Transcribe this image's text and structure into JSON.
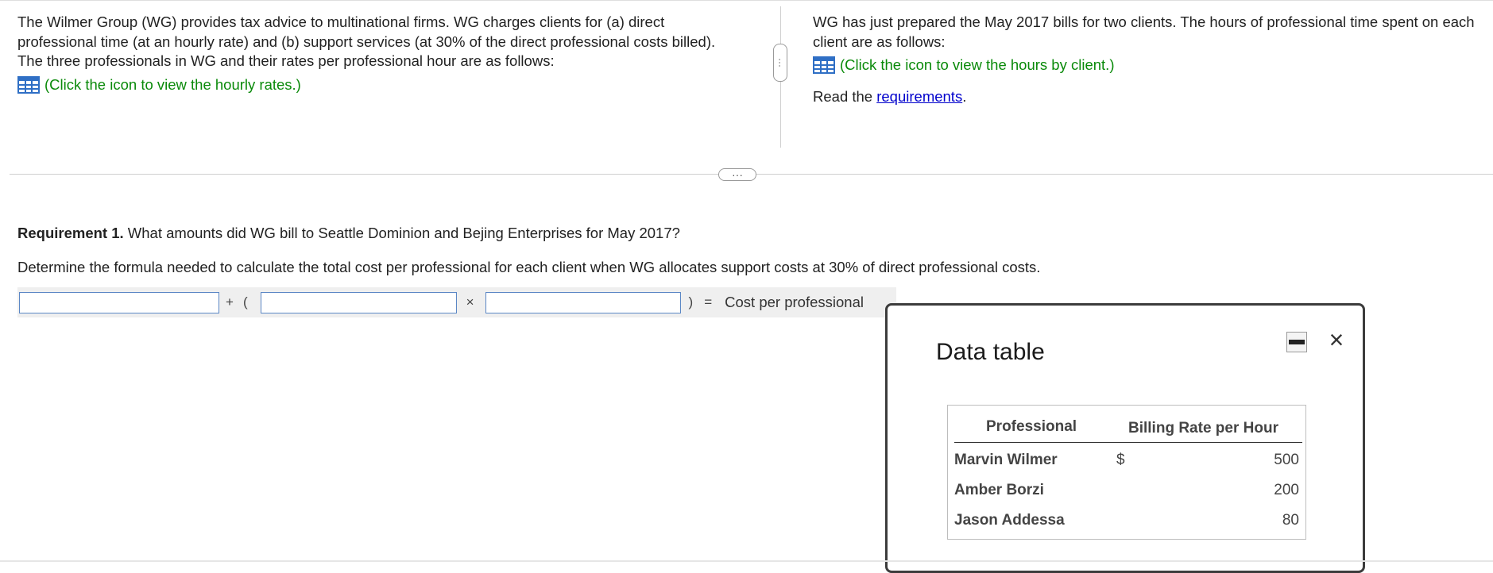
{
  "left_panel": {
    "paragraph": "The Wilmer Group (WG) provides tax advice to multinational firms. WG charges clients for (a) direct professional time (at an hourly rate) and (b) support services (at 30% of the direct professional costs billed). The three professionals in WG and their rates per professional hour are as follows:",
    "icon_link": "(Click the icon to view the hourly rates.)",
    "icon": "table-grid-icon"
  },
  "right_panel": {
    "paragraph": "WG has just prepared the May 2017 bills for two clients. The hours of professional time spent on each client are as follows:",
    "icon_link": "(Click the icon to view the hours by client.)",
    "icon": "table-grid-icon",
    "read_prefix": "Read the ",
    "requirements_link": "requirements",
    "read_suffix": "."
  },
  "requirement": {
    "label": "Requirement 1.",
    "question": " What amounts did WG bill to Seattle Dominion and Bejing Enterprises for May 2017?",
    "instruction": "Determine the formula needed to calculate the total cost per professional for each client when WG allocates support costs at 30% of direct professional costs."
  },
  "formula": {
    "plus": "+",
    "open_paren": "(",
    "times": "×",
    "close_paren": ")",
    "equals": "=",
    "result_label": "Cost per professional",
    "input1_value": "",
    "input2_value": "",
    "input3_value": ""
  },
  "modal": {
    "title": "Data table",
    "close_icon": "×",
    "minimize_icon": "minimize-icon",
    "table": {
      "headers": [
        "Professional",
        "Billing Rate per Hour"
      ],
      "currency_symbol": "$",
      "rows": [
        {
          "name": "Marvin Wilmer",
          "rate": "500"
        },
        {
          "name": "Amber Borzi",
          "rate": "200"
        },
        {
          "name": "Jason Addessa",
          "rate": "80"
        }
      ]
    }
  },
  "dividers": {
    "vertical_handle": "···",
    "horizontal_handle": "···"
  },
  "colors": {
    "link_green": "#0a8a0a",
    "link_blue": "#0000cc",
    "input_border": "#5b87c5",
    "formula_bg": "#efefef"
  }
}
